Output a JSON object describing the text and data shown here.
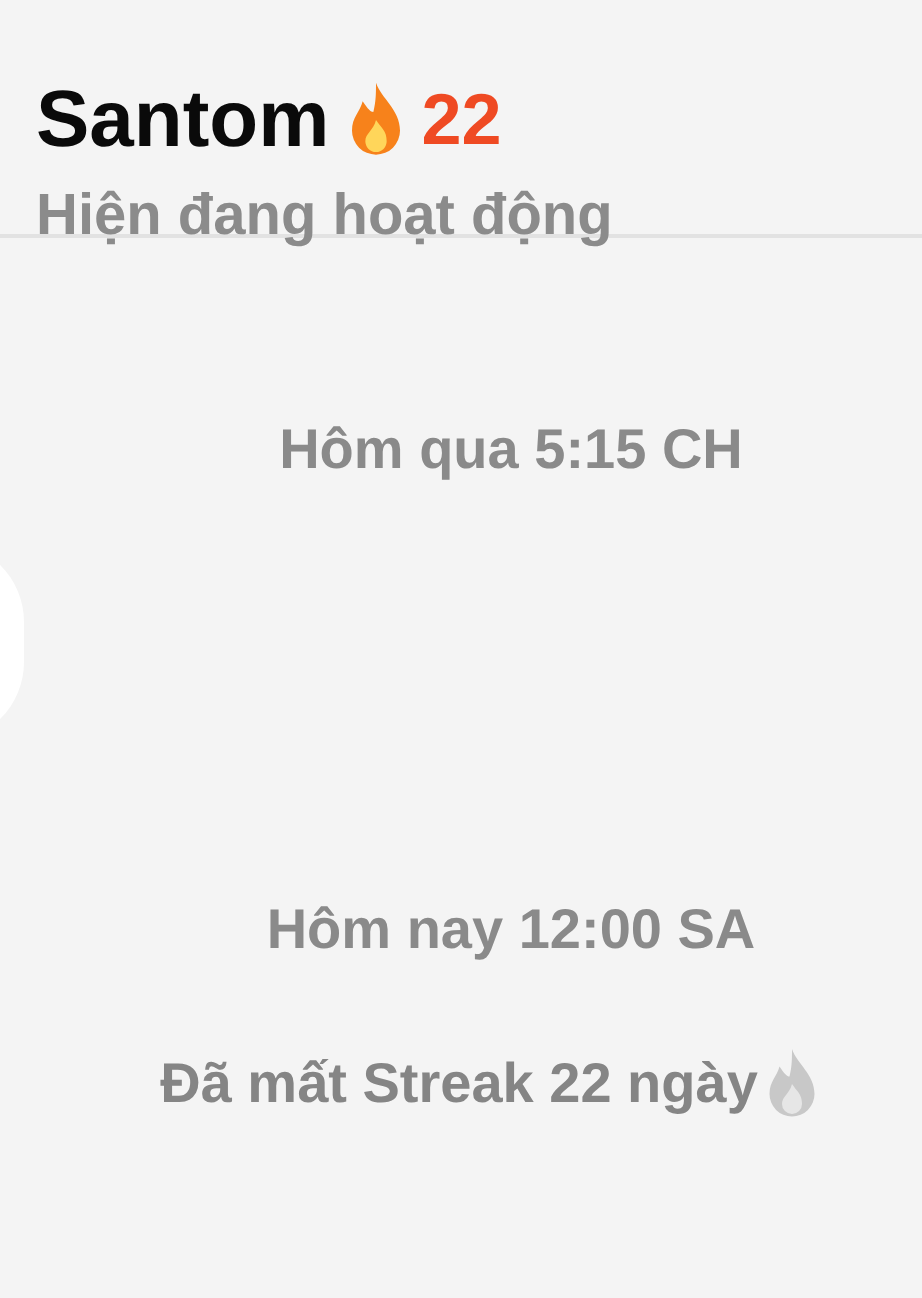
{
  "header": {
    "name": "Santom",
    "streak": {
      "count": "22",
      "active": true
    },
    "status": "Hiện đang hoạt động"
  },
  "chat": [
    {
      "kind": "timestamp",
      "text": "Hôm qua 5:15 CH"
    },
    {
      "kind": "bubble"
    },
    {
      "kind": "timestamp",
      "text": "Hôm nay 12:00 SA"
    },
    {
      "kind": "notice",
      "text": "Đã mất Streak 22 ngày",
      "active": false
    }
  ]
}
